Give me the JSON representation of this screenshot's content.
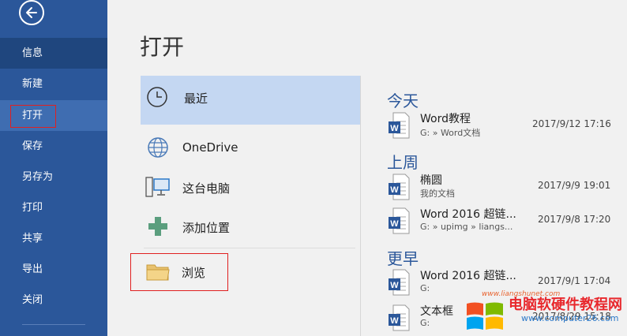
{
  "sidebar": {
    "items": [
      {
        "label": "信息"
      },
      {
        "label": "新建"
      },
      {
        "label": "打开"
      },
      {
        "label": "保存"
      },
      {
        "label": "另存为"
      },
      {
        "label": "打印"
      },
      {
        "label": "共享"
      },
      {
        "label": "导出"
      },
      {
        "label": "关闭"
      }
    ]
  },
  "page": {
    "title": "打开"
  },
  "locations": [
    {
      "label": "最近",
      "icon": "clock-icon"
    },
    {
      "label": "OneDrive",
      "icon": "globe-icon"
    },
    {
      "label": "这台电脑",
      "icon": "computer-icon"
    },
    {
      "label": "添加位置",
      "icon": "plus-icon"
    },
    {
      "label": "浏览",
      "icon": "folder-icon"
    }
  ],
  "recent": {
    "groups": [
      {
        "heading": "今天",
        "files": [
          {
            "name": "Word教程",
            "path": "G: » Word文档",
            "date": "2017/9/12 17:16"
          }
        ]
      },
      {
        "heading": "上周",
        "files": [
          {
            "name": "椭圆",
            "path": "我的文档",
            "date": "2017/9/9 19:01"
          },
          {
            "name": "Word 2016 超链...",
            "path": "G: » upimg » liangs...",
            "date": "2017/9/8 17:20"
          }
        ]
      },
      {
        "heading": "更早",
        "files": [
          {
            "name": "Word 2016 超链...",
            "path": "G:",
            "date": "2017/9/1 17:04"
          },
          {
            "name": "文本框",
            "path": "G:",
            "date": "2017/8/29 15:18"
          }
        ]
      }
    ]
  },
  "watermark": {
    "site_small": "www.liangshunet.com",
    "brand": "电脑软硬件教程网",
    "url": "www.computer26.com"
  },
  "colors": {
    "sidebar": "#2b579a",
    "accent": "#2b579a",
    "selection": "#c4d7f2"
  }
}
